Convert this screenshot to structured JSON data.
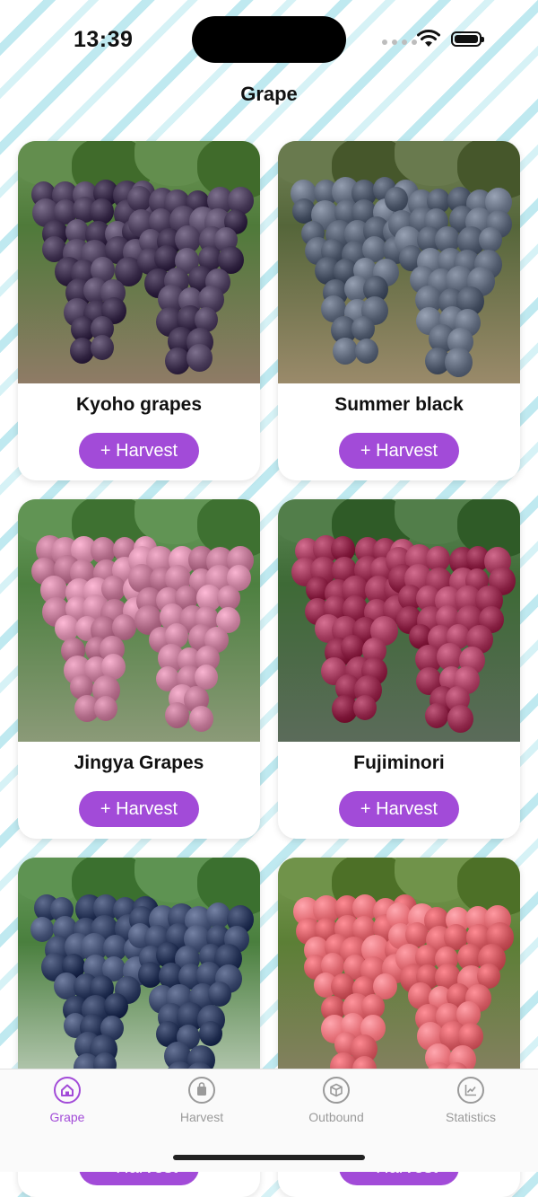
{
  "status_bar": {
    "time": "13:39"
  },
  "header": {
    "title": "Grape"
  },
  "varieties": [
    {
      "name": "Kyoho grapes",
      "button": "+ Harvest",
      "grape_color": "#3a2d4a",
      "leaf_color": "#4f7a3a",
      "bg_color": "#8f7b66"
    },
    {
      "name": "Summer black",
      "button": "+ Harvest",
      "grape_color": "#4b5567",
      "leaf_color": "#55663a",
      "bg_color": "#9a8a6a"
    },
    {
      "name": "Jingya Grapes",
      "button": "+ Harvest",
      "grape_color": "#b06b88",
      "leaf_color": "#4d8040",
      "bg_color": "#8b9a78"
    },
    {
      "name": "Fujiminori",
      "button": "+ Harvest",
      "grape_color": "#8a2446",
      "leaf_color": "#3e6a36",
      "bg_color": "#5b6b5a"
    },
    {
      "name": "",
      "button": "+ Harvest",
      "grape_color": "#283557",
      "leaf_color": "#4a7f3e",
      "bg_color": "#c7d4c4"
    },
    {
      "name": "",
      "button": "+ Harvest",
      "grape_color": "#cf5a62",
      "leaf_color": "#5c7f36",
      "bg_color": "#8c8068"
    }
  ],
  "tabbar": {
    "tabs": [
      {
        "label": "Grape",
        "icon": "home-icon",
        "active": true
      },
      {
        "label": "Harvest",
        "icon": "bag-icon",
        "active": false
      },
      {
        "label": "Outbound",
        "icon": "box-icon",
        "active": false
      },
      {
        "label": "Statistics",
        "icon": "chart-icon",
        "active": false
      }
    ]
  },
  "colors": {
    "accent": "#a24bd8",
    "inactive": "#9a9a9a"
  }
}
